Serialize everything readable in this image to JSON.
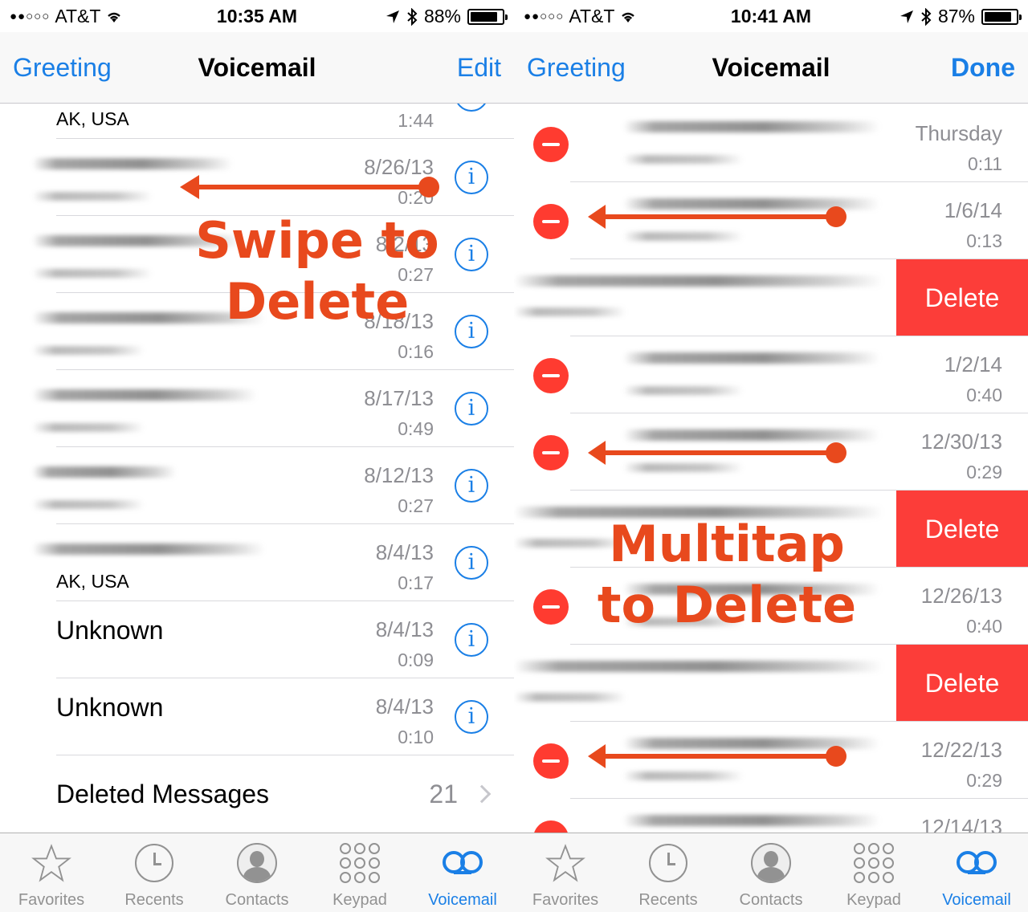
{
  "left": {
    "status": {
      "carrier": "AT&T",
      "signal_dots": "●●○○○",
      "time": "10:35 AM",
      "battery": "88%",
      "battery_level": 0.88
    },
    "nav": {
      "left": "Greeting",
      "title": "Voicemail",
      "right": "Edit"
    },
    "rows": [
      {
        "sub": "AK, USA",
        "date": "",
        "dur": "1:44"
      },
      {
        "date": "8/26/13",
        "dur": "0:20"
      },
      {
        "date": "8/2/13",
        "dur": "0:27"
      },
      {
        "date": "8/18/13",
        "dur": "0:16"
      },
      {
        "date": "8/17/13",
        "dur": "0:49"
      },
      {
        "date": "8/12/13",
        "dur": "0:27"
      },
      {
        "sub": "AK, USA",
        "date": "8/4/13",
        "dur": "0:17"
      },
      {
        "name": "Unknown",
        "date": "8/4/13",
        "dur": "0:09"
      },
      {
        "name": "Unknown",
        "date": "8/4/13",
        "dur": "0:10"
      }
    ],
    "info_glyph": "i",
    "deleted": {
      "label": "Deleted Messages",
      "count": "21"
    }
  },
  "right": {
    "status": {
      "carrier": "AT&T",
      "signal_dots": "●●○○○",
      "time": "10:41 AM",
      "battery": "87%",
      "battery_level": 0.87
    },
    "nav": {
      "left": "Greeting",
      "title": "Voicemail",
      "right": "Done"
    },
    "rows": [
      {
        "date": "Thursday",
        "dur": "0:11"
      },
      {
        "date": "1/6/14",
        "dur": "0:13"
      },
      {
        "delete": "Delete"
      },
      {
        "date": "1/2/14",
        "dur": "0:40"
      },
      {
        "date": "12/30/13",
        "dur": "0:29"
      },
      {
        "delete": "Delete"
      },
      {
        "date": "12/26/13",
        "dur": "0:40"
      },
      {
        "delete": "Delete"
      },
      {
        "date": "12/22/13",
        "dur": "0:29"
      },
      {
        "date": "12/14/13",
        "dur": ""
      }
    ]
  },
  "tabs": [
    {
      "label": "Favorites",
      "icon": "star-icon"
    },
    {
      "label": "Recents",
      "icon": "clock-icon"
    },
    {
      "label": "Contacts",
      "icon": "contacts-icon"
    },
    {
      "label": "Keypad",
      "icon": "keypad-icon"
    },
    {
      "label": "Voicemail",
      "icon": "voicemail-icon",
      "active": true
    }
  ],
  "annotations": {
    "swipe": [
      "Swipe to",
      "Delete"
    ],
    "multitap": [
      "Multitap",
      "to Delete"
    ]
  },
  "colors": {
    "accent": "#1a7fe6",
    "delete": "#fc3d39",
    "minus": "#ff3b30",
    "annotation": "#e8491d"
  }
}
